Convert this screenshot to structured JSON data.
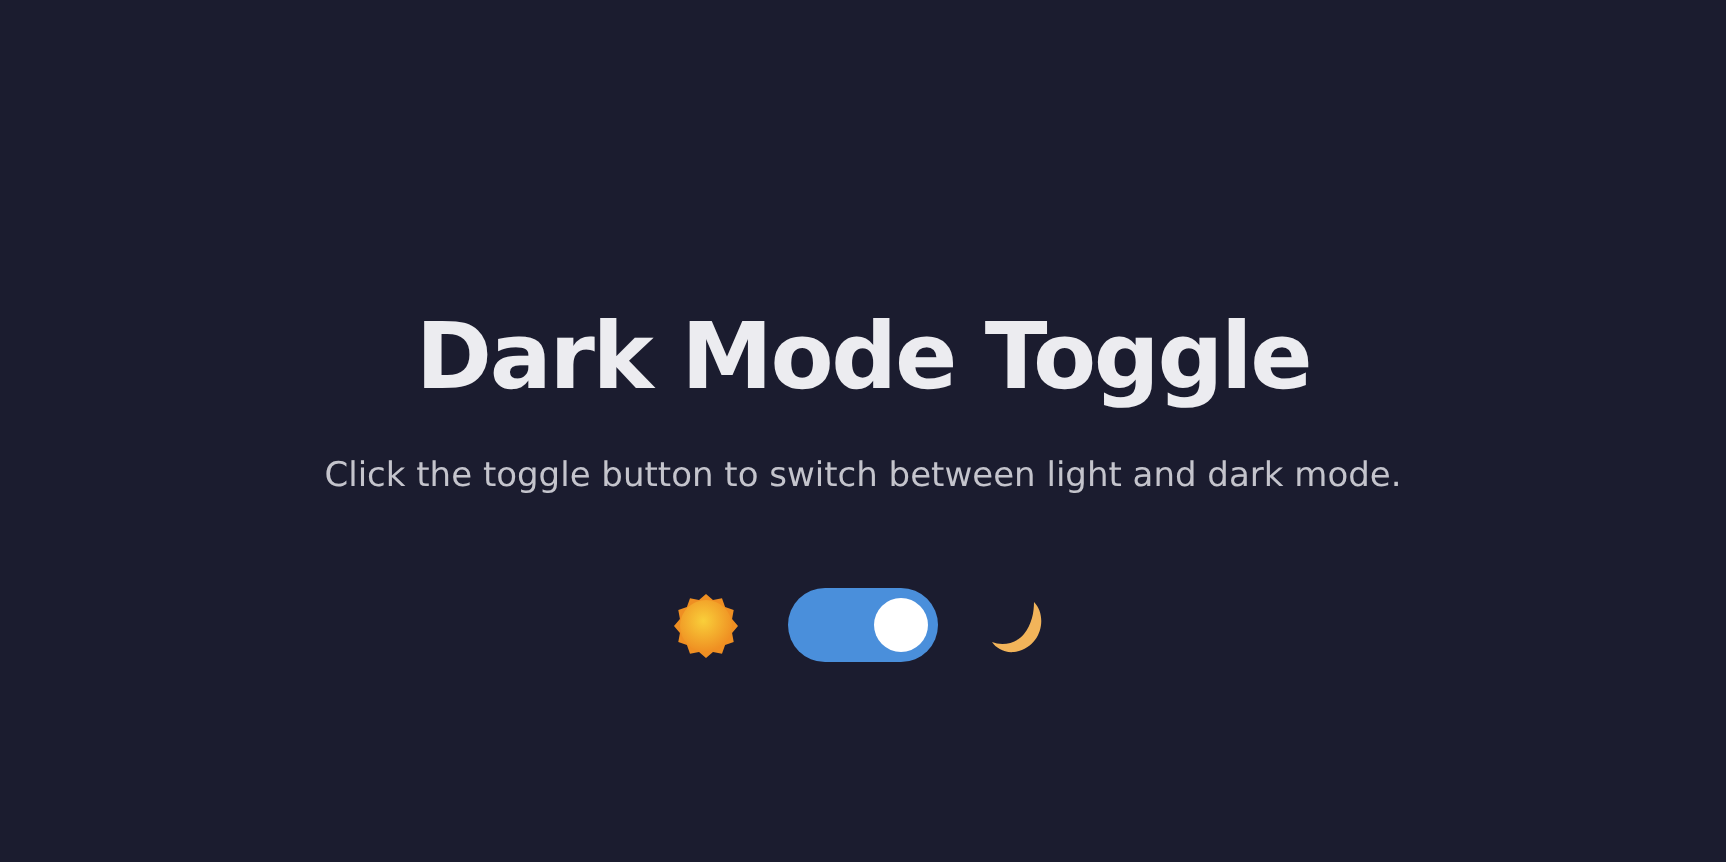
{
  "title": "Dark Mode Toggle",
  "description": "Click the toggle button to switch between light and dark mode.",
  "toggle": {
    "on": true
  }
}
